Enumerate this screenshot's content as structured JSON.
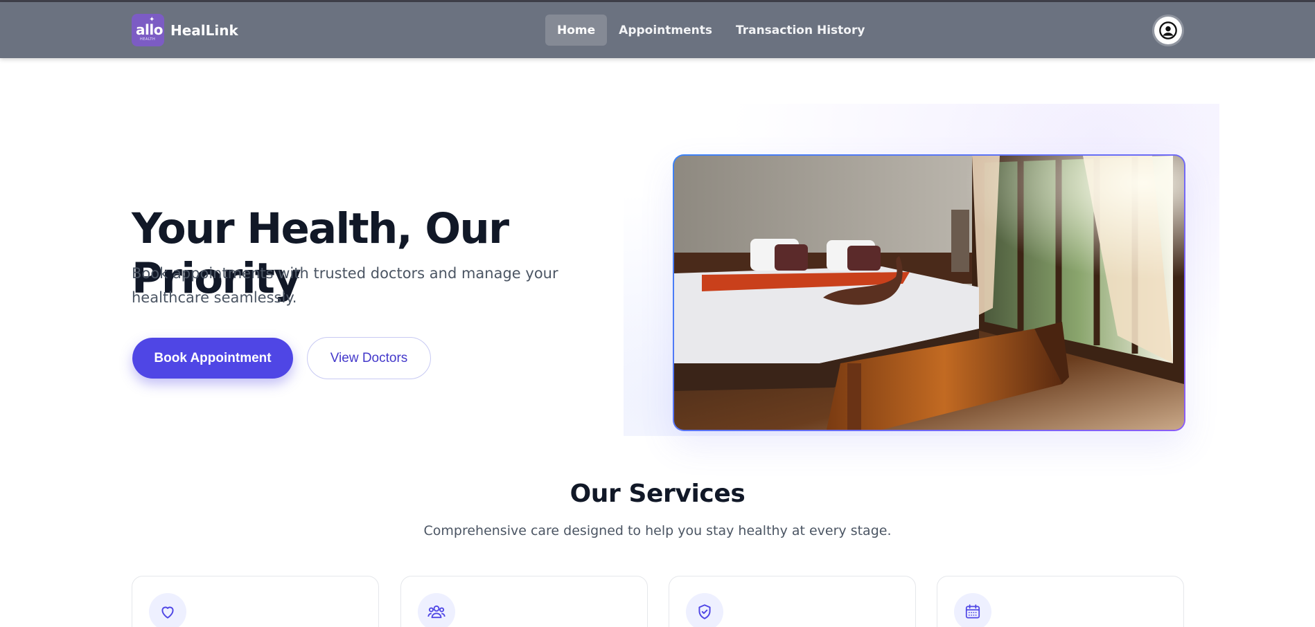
{
  "nav": {
    "brand_name": "HealLink",
    "logo": {
      "text": "allo",
      "sub": "HEALTH"
    },
    "links": [
      {
        "label": "Home",
        "active": true
      },
      {
        "label": "Appointments",
        "active": false
      },
      {
        "label": "Transaction History",
        "active": false
      }
    ],
    "profile_icon": "user-circle-icon"
  },
  "hero": {
    "title": "Your Health, Our Priority",
    "subtitle": "Book appointments with trusted doctors and manage your healthcare seamlessly.",
    "primary_button": "Book Appointment",
    "secondary_button": "View Doctors",
    "image": "bedroom-photo"
  },
  "services": {
    "title": "Our Services",
    "subtitle": "Comprehensive care designed to help you stay healthy at every stage.",
    "cards": [
      {
        "icon": "heart-icon"
      },
      {
        "icon": "users-icon"
      },
      {
        "icon": "shield-check-icon"
      },
      {
        "icon": "calendar-icon"
      }
    ]
  },
  "colors": {
    "navbar": "#6b7280",
    "primary": "#4f46e5",
    "heading": "#111827",
    "body_text": "#4b5563",
    "icon_bg": "#eef0ff"
  }
}
